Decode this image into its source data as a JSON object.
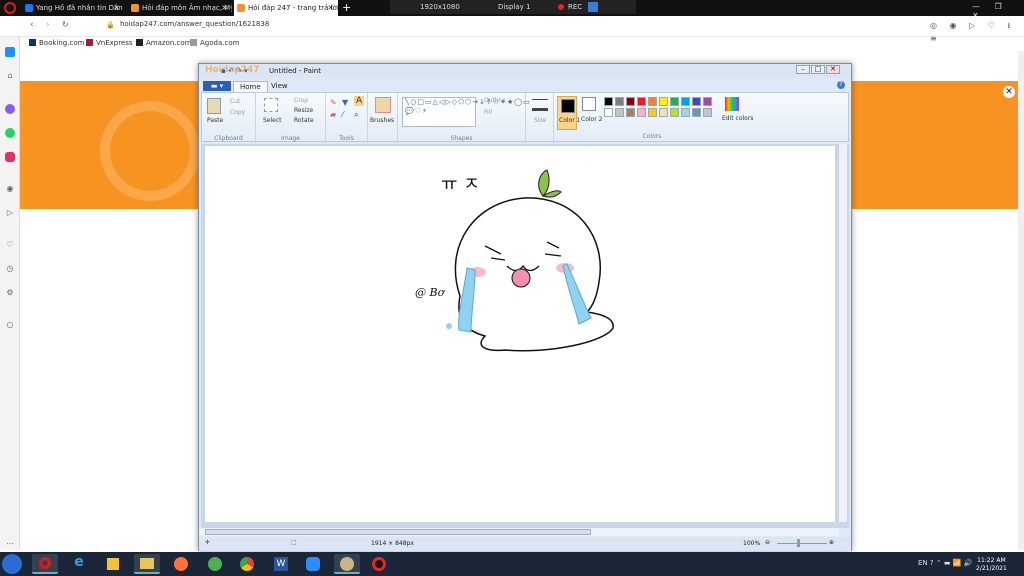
{
  "browser": {
    "tabs": [
      {
        "label": "Yang Hồ đã nhắn tin Dân"
      },
      {
        "label": "Hỏi đáp môn Âm nhạc, Mỹ"
      },
      {
        "label": "Hỏi đáp 247 - trang trả lời"
      }
    ],
    "new_tab": "+",
    "recording": {
      "resolution": "1920x1080",
      "display": "Display 1",
      "rec": "REC"
    },
    "url": "hoidap247.com/answer_question/1621838",
    "bookmarks": [
      "Booking.com",
      "VnExpress",
      "Amazon.com",
      "Agoda.com"
    ]
  },
  "paint": {
    "title": "Untitled - Paint",
    "site_logo": "Hoidap247",
    "tabs": [
      "Home",
      "View"
    ],
    "clipboard": {
      "paste": "Paste",
      "cut": "Cut",
      "copy": "Copy",
      "label": "Clipboard"
    },
    "image": {
      "select": "Select",
      "crop": "Crop",
      "resize": "Resize",
      "rotate": "Rotate",
      "label": "Image"
    },
    "tools": {
      "label": "Tools"
    },
    "brushes": "Brushes",
    "shapes": {
      "outline": "Outline",
      "fill": "Fill",
      "label": "Shapes"
    },
    "size": "Size",
    "color1": "Color 1",
    "color2": "Color 2",
    "edit_colors": "Edit colors",
    "colors_label": "Colors",
    "palette": [
      "#000000",
      "#7f7f7f",
      "#880015",
      "#ed1c24",
      "#ff7f27",
      "#fff200",
      "#22b14c",
      "#00a2e8",
      "#3f48cc",
      "#a349a4",
      "#ffffff",
      "#c3c3c3",
      "#b97a57",
      "#ffaec9",
      "#ffc90e",
      "#efe4b0",
      "#b5e61d",
      "#99d9ea",
      "#7092be",
      "#c8bfe7"
    ],
    "drawing": {
      "text_top": "ㅠ ㅈ",
      "signature": "@ Bơ"
    },
    "status": {
      "dimensions": "1914 × 848px",
      "zoom": "100%"
    }
  },
  "taskbar": {
    "lang": "EN",
    "time": "11:22 AM",
    "date": "2/21/2021"
  }
}
